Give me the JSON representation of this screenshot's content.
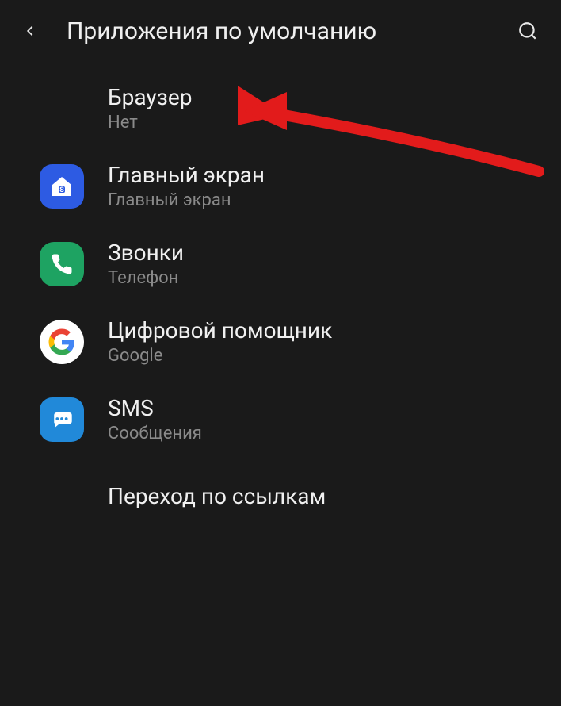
{
  "header": {
    "title": "Приложения по умолчанию"
  },
  "items": {
    "browser": {
      "title": "Браузер",
      "subtitle": "Нет"
    },
    "home": {
      "title": "Главный экран",
      "subtitle": "Главный экран"
    },
    "calls": {
      "title": "Звонки",
      "subtitle": "Телефон"
    },
    "assistant": {
      "title": "Цифровой помощник",
      "subtitle": "Google"
    },
    "sms": {
      "title": "SMS",
      "subtitle": "Сообщения"
    },
    "links": {
      "title": "Переход по ссылкам"
    }
  }
}
